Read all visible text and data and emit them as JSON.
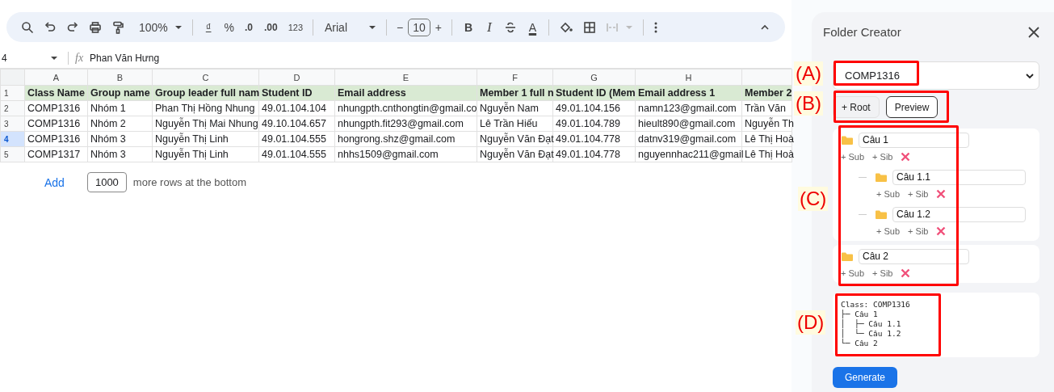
{
  "toolbar": {
    "zoom": "100%",
    "currency": "₫",
    "percent": "%",
    "decrease_decimals": ".0",
    "increase_decimals": ".00",
    "number_format": "123",
    "font": "Arial",
    "size_minus": "−",
    "font_size": "10",
    "size_plus": "+",
    "bold": "B",
    "italic": "I",
    "text_color": "A"
  },
  "formula_bar": {
    "cell_ref": "4",
    "fx": "fx",
    "value": "Phan Văn Hưng"
  },
  "sheet": {
    "columns": [
      "A",
      "B",
      "C",
      "D",
      "E",
      "F",
      "G",
      "H",
      ""
    ],
    "rows": [
      {
        "number": "1",
        "kind": "header",
        "selected": false,
        "cells": [
          "Class Name",
          "Group name",
          "Group leader full nam",
          "Student ID",
          "Email address",
          "Member 1 full n",
          "Student ID (Mem",
          "Email address 1",
          "Member 2"
        ]
      },
      {
        "number": "2",
        "kind": "data",
        "selected": false,
        "cells": [
          "COMP1316",
          "Nhóm 1",
          "Phan Thị Hồng Nhung",
          "49.01.104.104",
          "nhungpth.cnthongtin@gmail.co",
          "Nguyễn Nam",
          "49.01.104.156",
          "namn123@gmail.com",
          "Trần Văn"
        ]
      },
      {
        "number": "3",
        "kind": "data",
        "selected": false,
        "cells": [
          "COMP1316",
          "Nhóm 2",
          "Nguyễn Thị Mai Nhung",
          "49.10.104.657",
          "nhungpth.fit293@gmail.com",
          "Lê Trần Hiếu",
          "49.01.104.789",
          "hieult890@gmail.com",
          "Nguyễn Th"
        ]
      },
      {
        "number": "4",
        "kind": "data",
        "selected": true,
        "cells": [
          "COMP1316",
          "Nhóm 3",
          "Nguyễn Thị Linh",
          "49.01.104.555",
          "hongrong.shz@gmail.com",
          "Nguyễn Văn Đạt",
          "49.01.104.778",
          "datnv319@gmail.com",
          "Lê Thị Hoà"
        ]
      },
      {
        "number": "5",
        "kind": "data",
        "selected": false,
        "cells": [
          "COMP1317",
          "Nhóm 3",
          "Nguyễn Thị Linh",
          "49.01.104.555",
          "nhhs1509@gmail.com",
          "Nguyễn Văn Đạt",
          "49.01.104.778",
          "nguyennhac211@gmail",
          "Lê Thị Hoà"
        ]
      }
    ],
    "add_rows": {
      "button": "Add",
      "count": "1000",
      "suffix": "more rows at the bottom"
    }
  },
  "panel": {
    "title": "Folder Creator",
    "class_select": "COMP1316",
    "buttons": [
      "+ Root",
      "Preview"
    ],
    "tree": [
      {
        "name": "Câu 1",
        "actions": [
          "+ Sub",
          "+ Sib"
        ],
        "children": [
          {
            "name": "Câu 1.1",
            "actions": [
              "+ Sub",
              "+ Sib"
            ]
          },
          {
            "name": "Câu 1.2",
            "actions": [
              "+ Sub",
              "+ Sib"
            ]
          }
        ]
      },
      {
        "name": "Câu 2",
        "actions": [
          "+ Sub",
          "+ Sib"
        ]
      }
    ],
    "preview": [
      "Class: COMP1316",
      "├─ Câu 1",
      "│  ├─ Câu 1.1",
      "│  └─ Câu 1.2",
      "└─ Câu 2"
    ],
    "generate": "Generate"
  },
  "annotations": [
    {
      "label": "(A)"
    },
    {
      "label": "(B)"
    },
    {
      "label": "(C)"
    },
    {
      "label": "(D)"
    }
  ]
}
